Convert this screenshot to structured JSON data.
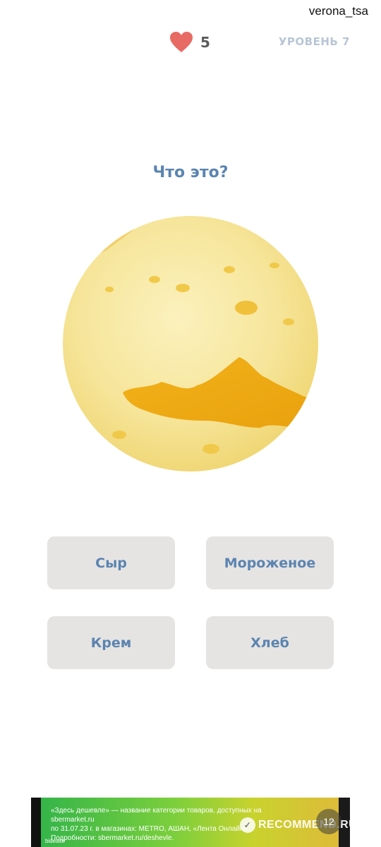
{
  "watermark": {
    "user": "verona_tsa"
  },
  "header": {
    "lives": "5",
    "level": "УРОВЕНЬ 7",
    "heart_color": "#e86a64",
    "level_color": "#b8c6d6"
  },
  "quiz": {
    "question": "Что это?",
    "image_icon": "cheese-photo",
    "accent_color": "#5b84b1",
    "answers": [
      {
        "label": "Сыр"
      },
      {
        "label": "Мороженое"
      },
      {
        "label": "Крем"
      },
      {
        "label": "Хлеб"
      }
    ],
    "answer_bg": "#e6e4e2"
  },
  "ad": {
    "text_line1": "«Здесь дешевле» — название категории товаров, доступных на sbermarket.ru",
    "text_line2": "по 31.07.23 г. в магазинах: METRO, АШАН, «Лента Онлайн».",
    "text_line3": "Подробности: sbermarket.ru/deshevle.",
    "brand": "bidease",
    "recommend": "RECOMMEND.RU",
    "badge": "12"
  }
}
